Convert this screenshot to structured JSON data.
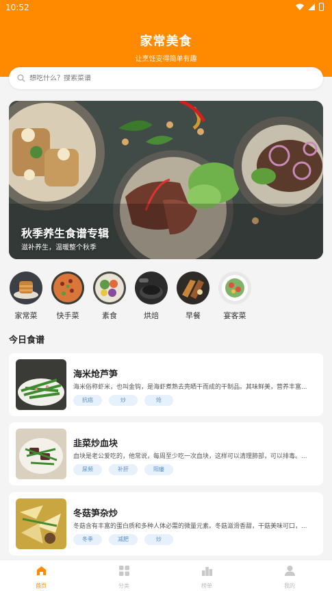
{
  "status_bar": {
    "time": "10:52"
  },
  "header": {
    "title": "家常美食",
    "subtitle": "让烹饪变得简单有趣"
  },
  "search": {
    "placeholder": "想吃什么？搜索菜谱"
  },
  "banner": {
    "title": "秋季养生食谱专辑",
    "subtitle": "滋补养生，温暖整个秋季"
  },
  "categories": [
    {
      "label": "家常菜",
      "color": "#6b4a2b"
    },
    {
      "label": "快手菜",
      "color": "#d9763a"
    },
    {
      "label": "素食",
      "color": "#5e9a4a"
    },
    {
      "label": "烘焙",
      "color": "#3a3a3a"
    },
    {
      "label": "早餐",
      "color": "#9b5a2e"
    },
    {
      "label": "宴客菜",
      "color": "#7fb36a"
    }
  ],
  "section": {
    "today": "今日食谱"
  },
  "recipes": [
    {
      "title": "海米炝芦笋",
      "desc": "海米俗称虾米，也叫金钩，是海虾煮熟去壳晒干而成的干制品。其味鲜美，营养丰富...",
      "tags": [
        "抗癌",
        "炒",
        "炝"
      ]
    },
    {
      "title": "韭菜炒血块",
      "desc": "血块是老公爱吃的，他常说，每周至少吃一次血块，这样可以清理肺部，可以排毒。...",
      "tags": [
        "尿频",
        "补肝",
        "阳痿"
      ]
    },
    {
      "title": "冬菇笋杂炒",
      "desc": "冬菇含有丰富的蛋白质和多种人体必需的微量元素。冬菇滋滑香甜，干菇美味可口，...",
      "tags": [
        "冬季",
        "减肥",
        "炒"
      ]
    }
  ],
  "tabbar": {
    "items": [
      {
        "label": "首页"
      },
      {
        "label": "分类"
      },
      {
        "label": "榜单"
      },
      {
        "label": "我的"
      }
    ]
  },
  "colors": {
    "brand": "#ff8a00",
    "tag_bg": "#e6f1fb",
    "tag_text": "#5b8fc2"
  }
}
